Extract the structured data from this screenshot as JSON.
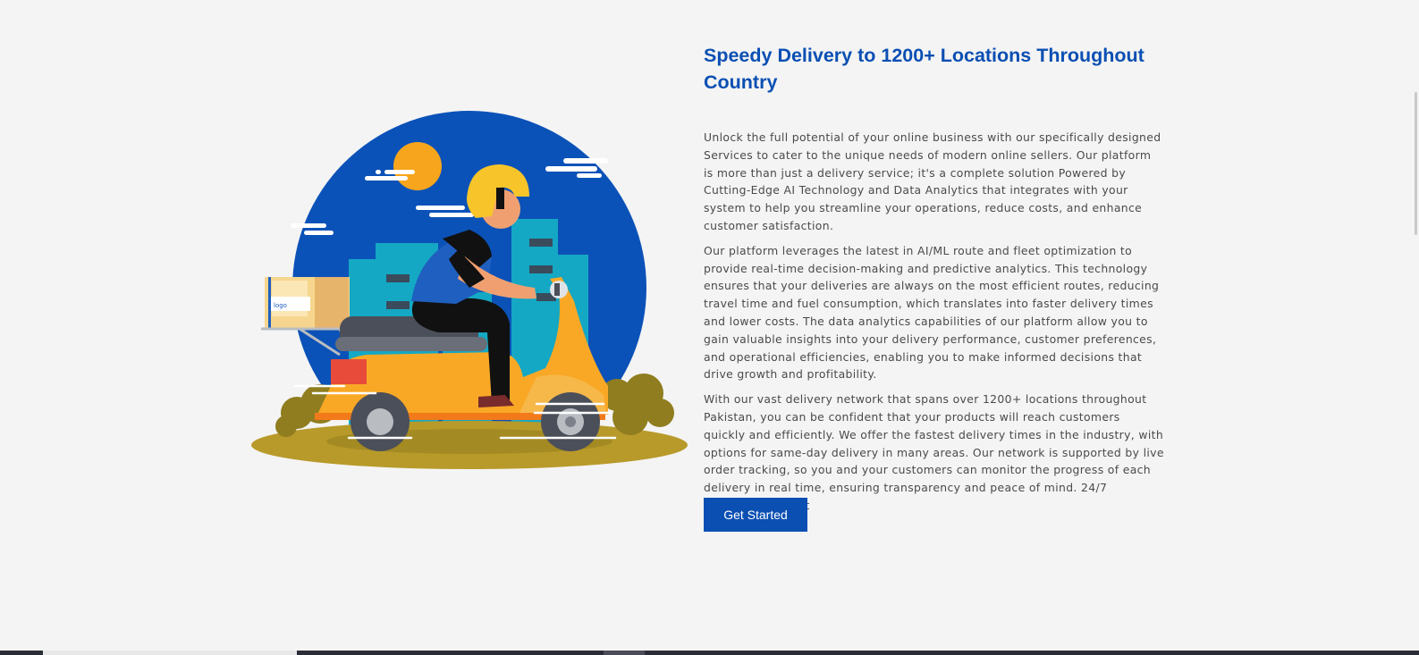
{
  "section": {
    "title": "Speedy Delivery to 1200+ Locations Throughout Country",
    "paragraphs": [
      "Unlock the full potential of your online business with our specifically designed Services to cater to the unique needs of modern online sellers. Our platform is more than just a delivery service; it's a complete solution Powered by Cutting-Edge AI Technology and Data Analytics that integrates with your system to help you streamline your operations, reduce costs, and enhance customer satisfaction.",
      "Our platform leverages the latest in AI/ML route and fleet optimization to provide real-time decision-making and predictive analytics. This technology ensures that your deliveries are always on the most efficient routes, reducing travel time and fuel consumption, which translates into faster delivery times and lower costs. The data analytics capabilities of our platform allow you to gain valuable insights into your delivery performance, customer preferences, and operational efficiencies, enabling you to make informed decisions that drive growth and profitability.",
      "With our vast delivery network that spans over 1200+ locations throughout Pakistan, you can be confident that your products will reach customers quickly and efficiently. We offer the fastest delivery times in the industry, with options for same-day delivery in many areas. Our network is supported by live order tracking, so you and your customers can monitor the progress of each delivery in real time, ensuring transparency and peace of mind. 24/7 Customer Support"
    ],
    "cta_label": "Get Started"
  },
  "illustration": {
    "icon": "delivery-scooter-illustration",
    "colors": {
      "sky": "#0b52b8",
      "sun": "#f7a51c",
      "buildings": "#14a8c4",
      "scooter": "#f9a826",
      "ground": "#b89a2a",
      "bushes": "#8f7d1f"
    }
  },
  "theme": {
    "accent": "#0b4fb3",
    "background": "#f4f4f4",
    "text": "#4a4a4a"
  }
}
